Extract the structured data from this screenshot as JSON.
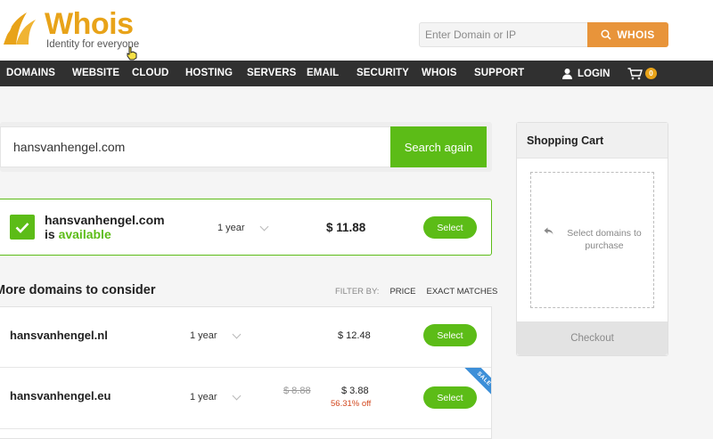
{
  "brand": {
    "name": "Whois",
    "tagline": "Identity for everyone"
  },
  "top_search": {
    "placeholder": "Enter Domain or IP",
    "button_label": "WHOIS"
  },
  "nav": {
    "items": [
      "DOMAINS",
      "WEBSITE",
      "CLOUD",
      "HOSTING",
      "SERVERS",
      "EMAIL",
      "SECURITY",
      "WHOIS",
      "SUPPORT"
    ],
    "login_label": "LOGIN",
    "cart_count": "0"
  },
  "search": {
    "value": "hansvanhengel.com",
    "button_label": "Search again"
  },
  "result": {
    "domain": "hansvanhengel.com",
    "is_text": "is",
    "status": "available",
    "period": "1 year",
    "price": "$ 11.88",
    "select_label": "Select"
  },
  "more": {
    "title": "More domains to consider",
    "filter_label": "FILTER BY:",
    "filter_price": "PRICE",
    "filter_exact": "EXACT MATCHES",
    "rows": [
      {
        "domain": "hansvanhengel.nl",
        "period": "1 year",
        "price": "$ 12.48",
        "select_label": "Select"
      },
      {
        "domain": "hansvanhengel.eu",
        "period": "1 year",
        "old_price": "$ 8.88",
        "price": "$ 3.88",
        "discount": "56.31% off",
        "badge": "SALE",
        "select_label": "Select"
      }
    ]
  },
  "cart": {
    "title": "Shopping Cart",
    "hint": "Select domains to purchase",
    "checkout_label": "Checkout"
  },
  "colors": {
    "brand_orange": "#e8a319",
    "button_orange": "#e8943a",
    "green": "#5cbc17",
    "nav_bg": "#303030",
    "discount_red": "#d2481f",
    "sale_blue": "#3d8fd8"
  }
}
